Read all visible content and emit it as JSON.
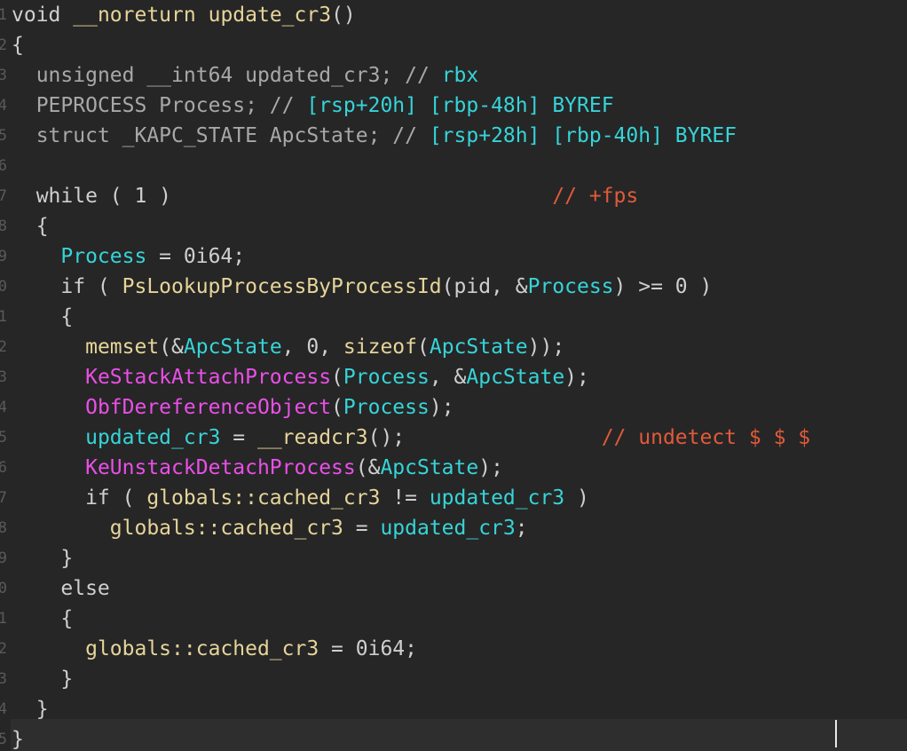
{
  "colors": {
    "background": "#262626",
    "keyword": "#cfcfcf",
    "type": "#d8c4a0",
    "function": "#e6d49a",
    "default": "#cfcfcf",
    "variable": "#36d4d8",
    "comment_gray": "#a8a8a8",
    "comment_cyan": "#36d4d8",
    "comment_red": "#e15a3a",
    "import_fn": "#ea4fe8",
    "number": "#cfcfcf",
    "line_number": "#5a5a5a"
  },
  "line_numbers": [
    "1",
    "2",
    "3",
    "4",
    "5",
    "6",
    "7",
    "8",
    "9",
    "0",
    "1",
    "2",
    "3",
    "4",
    "5",
    "6",
    "7",
    "8",
    "9",
    "0",
    "1",
    "2",
    "3",
    "4",
    "5"
  ],
  "lines": [
    [
      {
        "t": "void",
        "c": "keyword"
      },
      {
        "t": " ",
        "c": "default"
      },
      {
        "t": "__noreturn",
        "c": "function"
      },
      {
        "t": " ",
        "c": "default"
      },
      {
        "t": "update_cr3",
        "c": "function"
      },
      {
        "t": "()",
        "c": "default"
      }
    ],
    [
      {
        "t": "{",
        "c": "default"
      }
    ],
    [
      {
        "t": "  ",
        "c": "default"
      },
      {
        "t": "unsigned __int64",
        "c": "comment_gray"
      },
      {
        "t": " ",
        "c": "default"
      },
      {
        "t": "updated_cr3",
        "c": "comment_gray"
      },
      {
        "t": "; // ",
        "c": "comment_gray"
      },
      {
        "t": "rbx",
        "c": "comment_cyan"
      }
    ],
    [
      {
        "t": "  ",
        "c": "default"
      },
      {
        "t": "PEPROCESS Process",
        "c": "comment_gray"
      },
      {
        "t": "; // ",
        "c": "comment_gray"
      },
      {
        "t": "[rsp+20h] [rbp-48h]",
        "c": "comment_cyan"
      },
      {
        "t": " BYREF",
        "c": "comment_cyan"
      }
    ],
    [
      {
        "t": "  ",
        "c": "default"
      },
      {
        "t": "struct _KAPC_STATE ApcState",
        "c": "comment_gray"
      },
      {
        "t": "; // ",
        "c": "comment_gray"
      },
      {
        "t": "[rsp+28h] [rbp-40h]",
        "c": "comment_cyan"
      },
      {
        "t": " BYREF",
        "c": "comment_cyan"
      }
    ],
    [
      {
        "t": "",
        "c": "default"
      }
    ],
    [
      {
        "t": "  while ( 1 )",
        "c": "default"
      },
      {
        "t": "                               ",
        "c": "default"
      },
      {
        "t": "// +fps",
        "c": "comment_red"
      }
    ],
    [
      {
        "t": "  {",
        "c": "default"
      }
    ],
    [
      {
        "t": "    ",
        "c": "default"
      },
      {
        "t": "Process",
        "c": "variable"
      },
      {
        "t": " = 0i64;",
        "c": "default"
      }
    ],
    [
      {
        "t": "    if ( ",
        "c": "default"
      },
      {
        "t": "PsLookupProcessByProcessId",
        "c": "function"
      },
      {
        "t": "(pid, &",
        "c": "default"
      },
      {
        "t": "Process",
        "c": "variable"
      },
      {
        "t": ") >= 0 )",
        "c": "default"
      }
    ],
    [
      {
        "t": "    {",
        "c": "default"
      }
    ],
    [
      {
        "t": "      ",
        "c": "default"
      },
      {
        "t": "memset",
        "c": "function"
      },
      {
        "t": "(&",
        "c": "default"
      },
      {
        "t": "ApcState",
        "c": "variable"
      },
      {
        "t": ", 0, ",
        "c": "default"
      },
      {
        "t": "sizeof",
        "c": "function"
      },
      {
        "t": "(",
        "c": "default"
      },
      {
        "t": "ApcState",
        "c": "variable"
      },
      {
        "t": "));",
        "c": "default"
      }
    ],
    [
      {
        "t": "      ",
        "c": "default"
      },
      {
        "t": "KeStackAttachProcess",
        "c": "import_fn"
      },
      {
        "t": "(",
        "c": "default"
      },
      {
        "t": "Process",
        "c": "variable"
      },
      {
        "t": ", &",
        "c": "default"
      },
      {
        "t": "ApcState",
        "c": "variable"
      },
      {
        "t": ");",
        "c": "default"
      }
    ],
    [
      {
        "t": "      ",
        "c": "default"
      },
      {
        "t": "ObfDereferenceObject",
        "c": "import_fn"
      },
      {
        "t": "(",
        "c": "default"
      },
      {
        "t": "Process",
        "c": "variable"
      },
      {
        "t": ");",
        "c": "default"
      }
    ],
    [
      {
        "t": "      ",
        "c": "default"
      },
      {
        "t": "updated_cr3",
        "c": "variable"
      },
      {
        "t": " = ",
        "c": "default"
      },
      {
        "t": "__readcr3",
        "c": "function"
      },
      {
        "t": "();",
        "c": "default"
      },
      {
        "t": "                ",
        "c": "default"
      },
      {
        "t": "// undetect $ $ $",
        "c": "comment_red"
      }
    ],
    [
      {
        "t": "      ",
        "c": "default"
      },
      {
        "t": "KeUnstackDetachProcess",
        "c": "import_fn"
      },
      {
        "t": "(&",
        "c": "default"
      },
      {
        "t": "ApcState",
        "c": "variable"
      },
      {
        "t": ");",
        "c": "default"
      }
    ],
    [
      {
        "t": "      if ( ",
        "c": "default"
      },
      {
        "t": "globals::cached_cr3",
        "c": "function"
      },
      {
        "t": " != ",
        "c": "default"
      },
      {
        "t": "updated_cr3",
        "c": "variable"
      },
      {
        "t": " )",
        "c": "default"
      }
    ],
    [
      {
        "t": "        ",
        "c": "default"
      },
      {
        "t": "globals::cached_cr3",
        "c": "function"
      },
      {
        "t": " = ",
        "c": "default"
      },
      {
        "t": "updated_cr3",
        "c": "variable"
      },
      {
        "t": ";",
        "c": "default"
      }
    ],
    [
      {
        "t": "    }",
        "c": "default"
      }
    ],
    [
      {
        "t": "    else",
        "c": "default"
      }
    ],
    [
      {
        "t": "    {",
        "c": "default"
      }
    ],
    [
      {
        "t": "      ",
        "c": "default"
      },
      {
        "t": "globals::cached_cr3",
        "c": "function"
      },
      {
        "t": " = 0i64;",
        "c": "default"
      }
    ],
    [
      {
        "t": "    }",
        "c": "default"
      }
    ],
    [
      {
        "t": "  }",
        "c": "default"
      }
    ],
    [
      {
        "t": "}",
        "c": "default"
      }
    ]
  ]
}
